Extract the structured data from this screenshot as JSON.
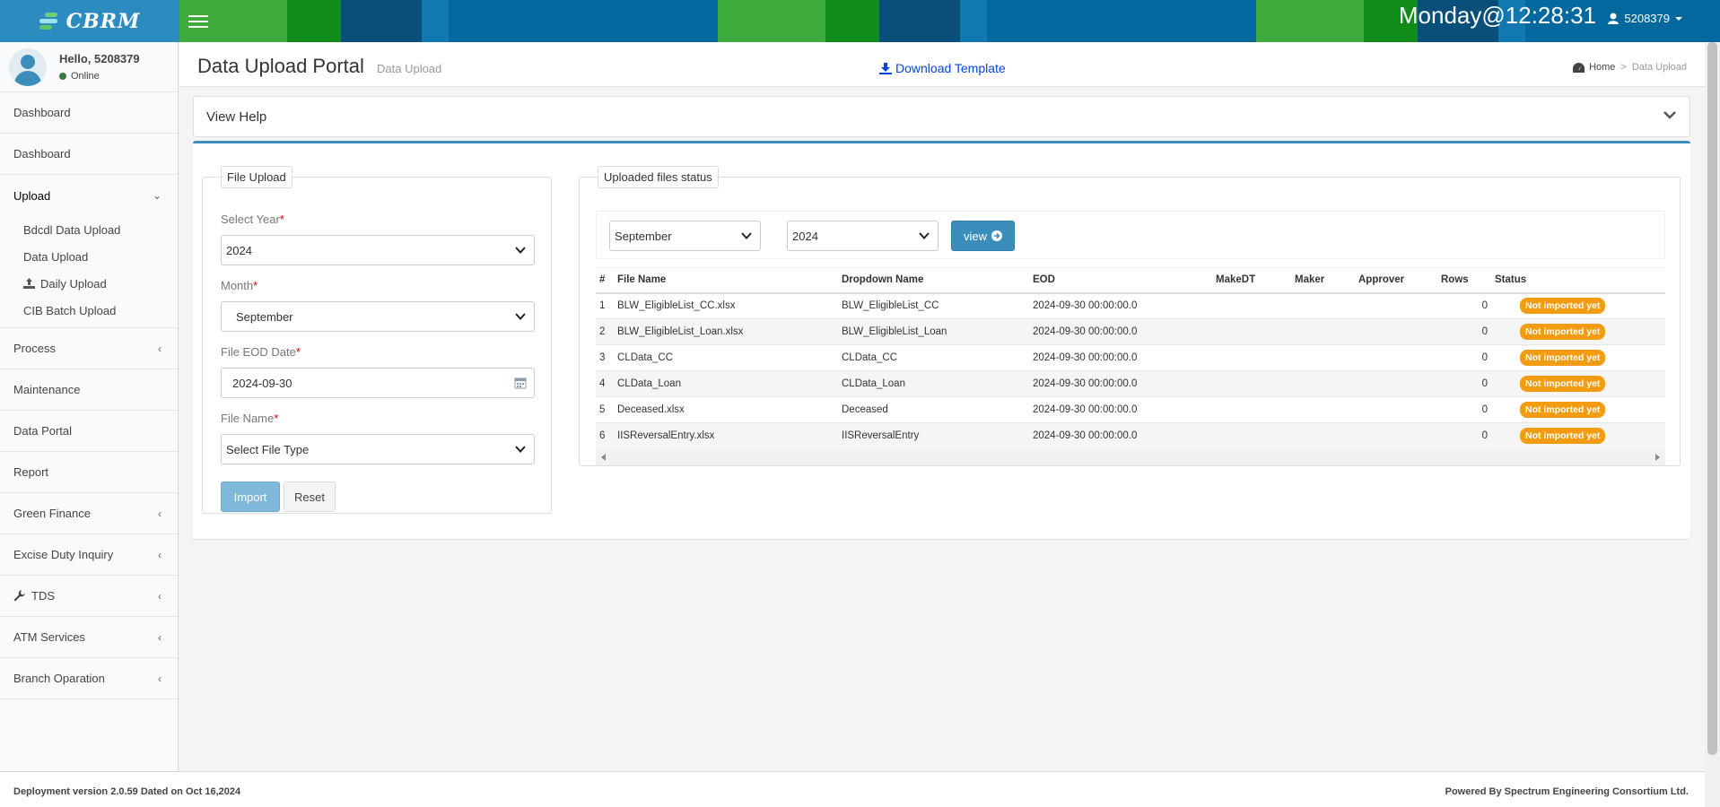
{
  "header": {
    "logo_text": "CBRM",
    "clock": "Monday@12:28:31",
    "user_id": "5208379",
    "accent_color": "#03689e"
  },
  "sidebar": {
    "greeting": "Hello, 5208379",
    "status": "Online",
    "items": [
      {
        "label": "Dashboard",
        "chevron": ""
      },
      {
        "label": "Dashboard",
        "chevron": ""
      },
      {
        "label": "Upload",
        "chevron": "down"
      },
      {
        "label": "Process",
        "chevron": "left"
      },
      {
        "label": "Maintenance",
        "chevron": ""
      },
      {
        "label": "Data Portal",
        "chevron": ""
      },
      {
        "label": "Report",
        "chevron": ""
      },
      {
        "label": "Green Finance",
        "chevron": "left"
      },
      {
        "label": "Excise Duty Inquiry",
        "chevron": "left"
      },
      {
        "label": "TDS",
        "chevron": "left",
        "icon": "wrench-icon"
      },
      {
        "label": "ATM Services",
        "chevron": "left"
      },
      {
        "label": "Branch Oparation",
        "chevron": "left"
      }
    ],
    "upload_submenu": [
      {
        "label": "Bdcdl Data Upload"
      },
      {
        "label": "Data Upload"
      },
      {
        "label": "Daily Upload",
        "icon": "upload-icon"
      },
      {
        "label": "CIB Batch Upload"
      }
    ]
  },
  "page": {
    "title": "Data Upload Portal",
    "subtitle": "Data Upload",
    "download_label": "Download Template",
    "breadcrumb_home": "Home",
    "breadcrumb_current": "Data Upload",
    "help_title": "View Help"
  },
  "upload_form": {
    "legend": "File Upload",
    "year_label": "Select Year",
    "year_value": "2024",
    "month_label": "Month",
    "month_value": "September",
    "eod_label": "File EOD Date",
    "eod_value": "2024-09-30",
    "filename_label": "File Name",
    "filename_value": "Select File Type",
    "required_mark": "*",
    "import_label": "Import",
    "reset_label": "Reset"
  },
  "status_panel": {
    "legend": "Uploaded files status",
    "month_value": "September",
    "year_value": "2024",
    "view_label": "view",
    "columns": [
      "#",
      "File Name",
      "Dropdown Name",
      "EOD",
      "MakeDT",
      "Maker",
      "Approver",
      "Rows",
      "Status"
    ],
    "rows": [
      {
        "n": "1",
        "file": "BLW_EligibleList_CC.xlsx",
        "dropdown": "BLW_EligibleList_CC",
        "eod": "2024-09-30 00:00:00.0",
        "makedt": "",
        "maker": "",
        "approver": "",
        "rows": "0",
        "status": "Not imported yet"
      },
      {
        "n": "2",
        "file": "BLW_EligibleList_Loan.xlsx",
        "dropdown": "BLW_EligibleList_Loan",
        "eod": "2024-09-30 00:00:00.0",
        "makedt": "",
        "maker": "",
        "approver": "",
        "rows": "0",
        "status": "Not imported yet"
      },
      {
        "n": "3",
        "file": "CLData_CC",
        "dropdown": "CLData_CC",
        "eod": "2024-09-30 00:00:00.0",
        "makedt": "",
        "maker": "",
        "approver": "",
        "rows": "0",
        "status": "Not imported yet"
      },
      {
        "n": "4",
        "file": "CLData_Loan",
        "dropdown": "CLData_Loan",
        "eod": "2024-09-30 00:00:00.0",
        "makedt": "",
        "maker": "",
        "approver": "",
        "rows": "0",
        "status": "Not imported yet"
      },
      {
        "n": "5",
        "file": "Deceased.xlsx",
        "dropdown": "Deceased",
        "eod": "2024-09-30 00:00:00.0",
        "makedt": "",
        "maker": "",
        "approver": "",
        "rows": "0",
        "status": "Not imported yet"
      },
      {
        "n": "6",
        "file": "IISReversalEntry.xlsx",
        "dropdown": "IISReversalEntry",
        "eod": "2024-09-30 00:00:00.0",
        "makedt": "",
        "maker": "",
        "approver": "",
        "rows": "0",
        "status": "Not imported yet"
      }
    ],
    "status_color": "#f39c12"
  },
  "footer": {
    "left": "Deployment version 2.0.59 Dated on Oct 16,2024",
    "right": "Powered By Spectrum Engineering Consortium Ltd."
  }
}
